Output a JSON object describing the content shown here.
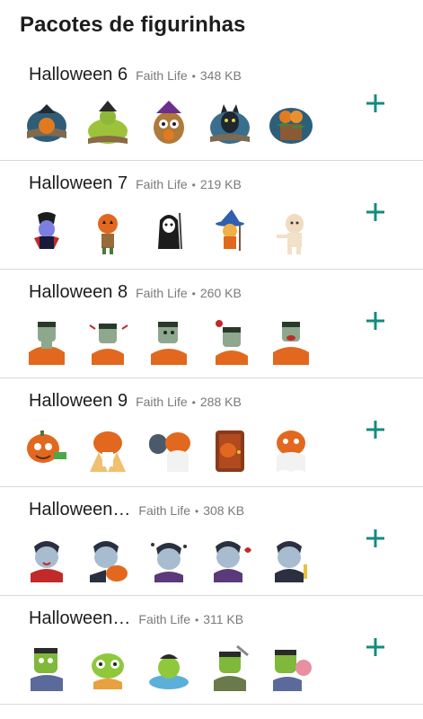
{
  "title": "Pacotes de figurinhas",
  "accent_color": "#128C7E",
  "packs": [
    {
      "name": "Halloween 6",
      "author": "Faith Life",
      "separator": "•",
      "size": "348 KB",
      "stickers": [
        "pumpkin-banner-sticker",
        "witch-cauldron-sticker",
        "owl-witch-sticker",
        "black-cat-sticker",
        "pumpkin-patch-sticker"
      ]
    },
    {
      "name": "Halloween 7",
      "author": "Faith Life",
      "separator": "•",
      "size": "219 KB",
      "stickers": [
        "vampire-sticker",
        "pumpkin-scarecrow-sticker",
        "grim-reaper-sticker",
        "witch-sticker",
        "mummy-sticker"
      ]
    },
    {
      "name": "Halloween 8",
      "author": "Faith Life",
      "separator": "•",
      "size": "260 KB",
      "stickers": [
        "frankenstein-sticker",
        "frankenstein-sticker",
        "frankenstein-sticker",
        "frankenstein-sticker",
        "frankenstein-sticker"
      ]
    },
    {
      "name": "Halloween 9",
      "author": "Faith Life",
      "separator": "•",
      "size": "288 KB",
      "stickers": [
        "pumpkin-money-sticker",
        "pumpkin-pray-sticker",
        "pumpkin-ghost-sticker",
        "pumpkin-door-sticker",
        "pumpkin-ghost-sticker"
      ]
    },
    {
      "name": "Halloween…",
      "author": "Faith Life",
      "separator": "•",
      "size": "308 KB",
      "stickers": [
        "dracula-sticker",
        "dracula-sticker",
        "dracula-sticker",
        "dracula-sticker",
        "dracula-sticker"
      ]
    },
    {
      "name": "Halloween…",
      "author": "Faith Life",
      "separator": "•",
      "size": "311 KB",
      "stickers": [
        "zombie-sticker",
        "zombie-sticker",
        "zombie-sticker",
        "zombie-sticker",
        "zombie-sticker"
      ]
    }
  ]
}
